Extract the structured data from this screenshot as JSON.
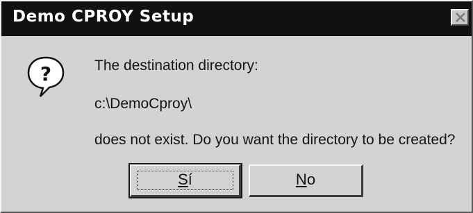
{
  "window": {
    "title": "Demo CPROY Setup"
  },
  "icons": {
    "message_icon": "question-icon",
    "close_icon": "close-icon"
  },
  "message": {
    "line1": "The destination directory:",
    "line2": "c:\\DemoCproy\\",
    "line3": "does not exist.  Do you want the directory to be created?"
  },
  "buttons": {
    "yes": {
      "mnemonic": "S",
      "rest": "í"
    },
    "no": {
      "mnemonic": "N",
      "rest": "o"
    }
  }
}
